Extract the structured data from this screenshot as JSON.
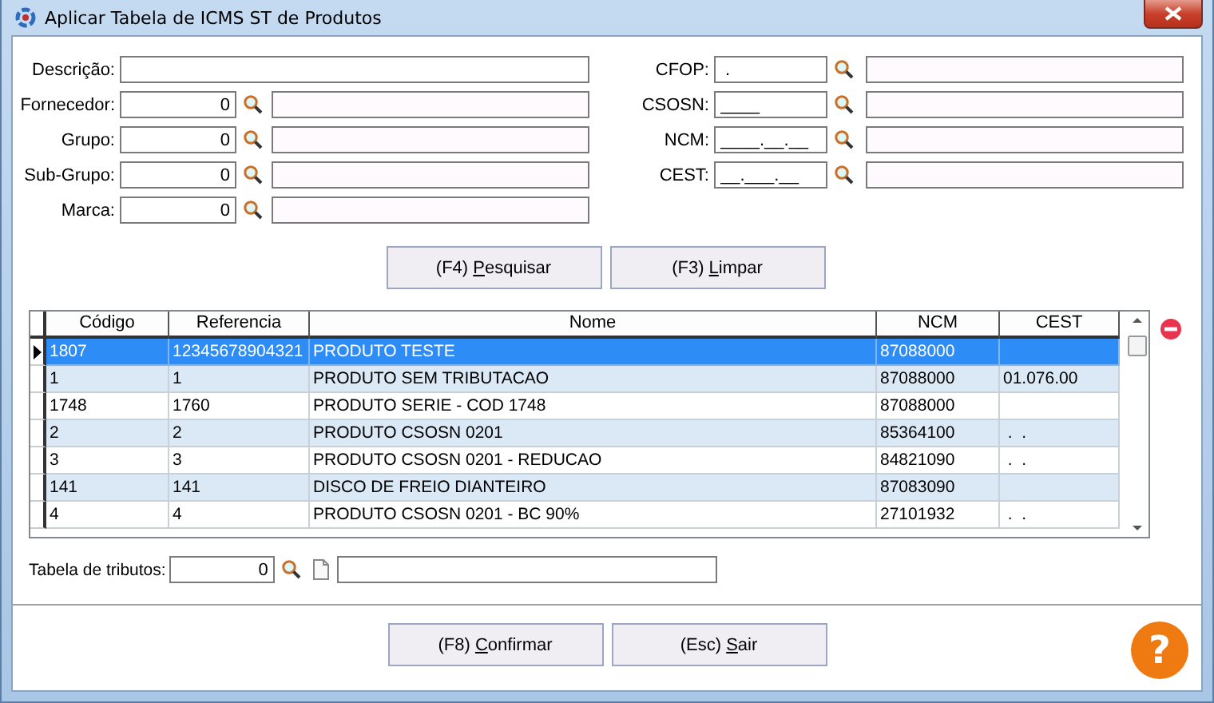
{
  "window": {
    "title": "Aplicar Tabela de ICMS ST de Produtos"
  },
  "filters_left": [
    {
      "kind": "text",
      "label": "Descrição:"
    },
    {
      "kind": "numeric_lookup",
      "label": "Fornecedor:",
      "code": "0"
    },
    {
      "kind": "numeric_lookup",
      "label": "Grupo:",
      "code": "0"
    },
    {
      "kind": "numeric_lookup",
      "label": "Sub-Grupo:",
      "code": "0"
    },
    {
      "kind": "numeric_lookup",
      "label": "Marca:",
      "code": "0"
    }
  ],
  "filters_right": [
    {
      "kind": "masked_lookup",
      "label": "CFOP:",
      "code": " ."
    },
    {
      "kind": "masked_lookup",
      "label": "CSOSN:",
      "code": "____"
    },
    {
      "kind": "masked_lookup",
      "label": "NCM:",
      "code": "____.__.__"
    },
    {
      "kind": "masked_lookup",
      "label": "CEST:",
      "code": "__.___.__"
    }
  ],
  "search_buttons": [
    {
      "before": "(F4) ",
      "key": "P",
      "after": "esquisar"
    },
    {
      "before": "(F3) ",
      "key": "L",
      "after": "impar"
    }
  ],
  "table": {
    "columns": [
      "Código",
      "Referencia",
      "Nome",
      "NCM",
      "CEST"
    ],
    "rows": [
      {
        "selected": true,
        "cells": [
          "1807",
          "12345678904321",
          "PRODUTO TESTE",
          "87088000",
          null
        ]
      },
      {
        "selected": false,
        "cells": [
          "1",
          "1",
          "PRODUTO SEM TRIBUTACAO",
          "87088000",
          "01.076.00"
        ]
      },
      {
        "selected": false,
        "cells": [
          "1748",
          "1760",
          "PRODUTO SERIE - COD 1748",
          "87088000",
          null
        ]
      },
      {
        "selected": false,
        "cells": [
          "2",
          "2",
          "PRODUTO CSOSN 0201",
          "85364100",
          " .  ."
        ]
      },
      {
        "selected": false,
        "cells": [
          "3",
          "3",
          "PRODUTO CSOSN 0201 - REDUCAO",
          "84821090",
          " .  ."
        ]
      },
      {
        "selected": false,
        "cells": [
          "141",
          "141",
          "DISCO DE FREIO DIANTEIRO",
          "87083090",
          null
        ]
      },
      {
        "selected": false,
        "cells": [
          "4",
          "4",
          "PRODUTO CSOSN 0201 - BC 90%",
          "27101932",
          " .  ."
        ]
      }
    ]
  },
  "tributos": {
    "label": "Tabela de tributos:",
    "code": "0"
  },
  "actions": [
    {
      "before": "(F8) ",
      "key": "C",
      "after": "onfirmar"
    },
    {
      "before": "(Esc) ",
      "key": "S",
      "after": "air"
    }
  ],
  "help": {
    "label": "?"
  }
}
